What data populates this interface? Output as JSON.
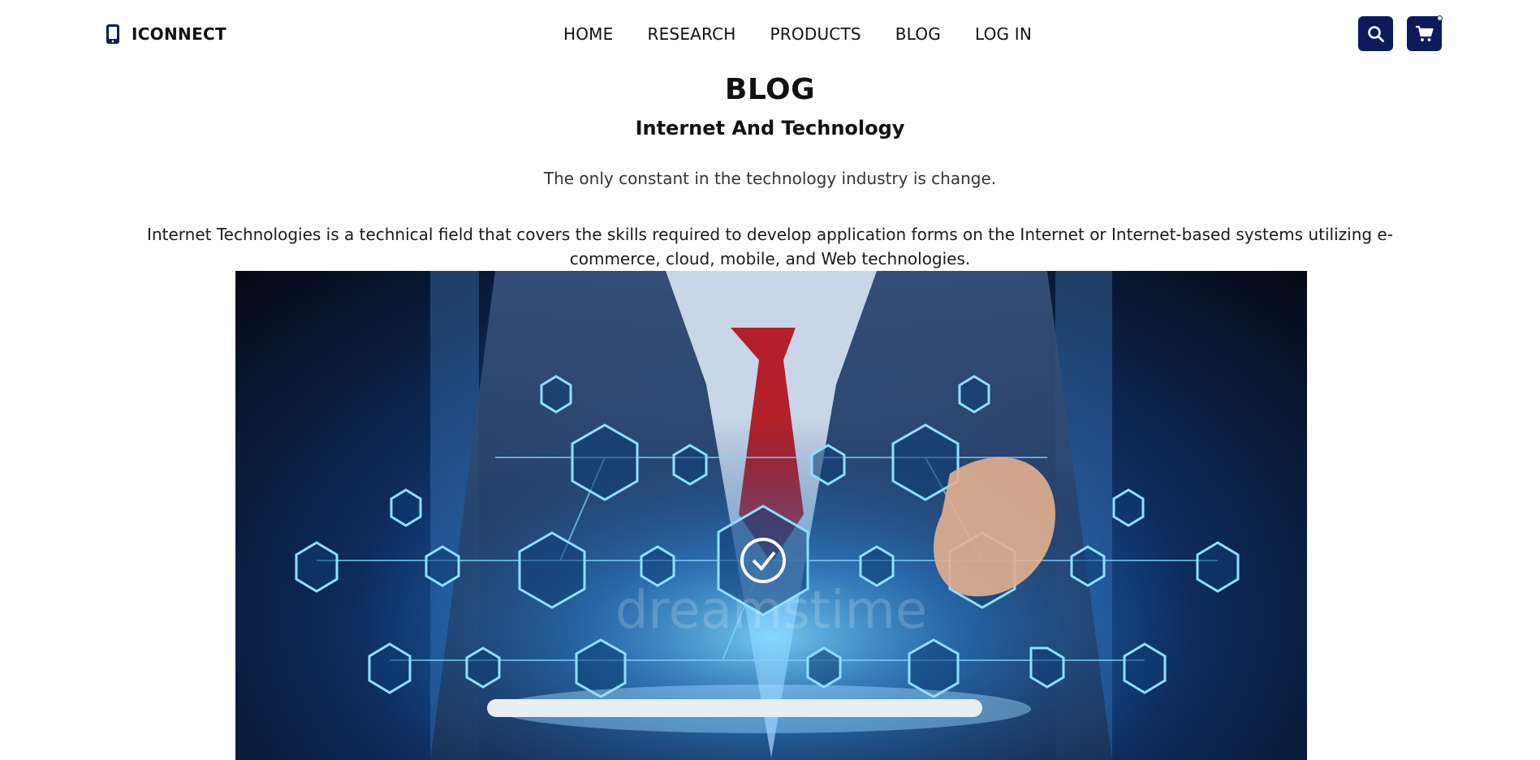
{
  "brand": {
    "name": "ICONNECT",
    "icon": "phone-icon"
  },
  "nav": {
    "items": [
      {
        "label": "HOME"
      },
      {
        "label": "RESEARCH"
      },
      {
        "label": "PRODUCTS"
      },
      {
        "label": "BLOG"
      },
      {
        "label": "LOG IN"
      }
    ]
  },
  "actions": {
    "search_icon": "search-icon",
    "cart_icon": "cart-icon"
  },
  "main": {
    "title": "BLOG",
    "subtitle": "Internet And Technology",
    "tagline": "The only constant in the technology industry is change.",
    "body": "Internet Technologies is a technical field that covers the skills required to develop application forms on the Internet or Internet-based systems utilizing e-commerce, cloud, mobile, and Web technologies.",
    "hero_watermark": "dreamstime"
  },
  "colors": {
    "accent": "#0f1a5e",
    "text": "#111111",
    "hero_glow": "#36a8ff"
  }
}
